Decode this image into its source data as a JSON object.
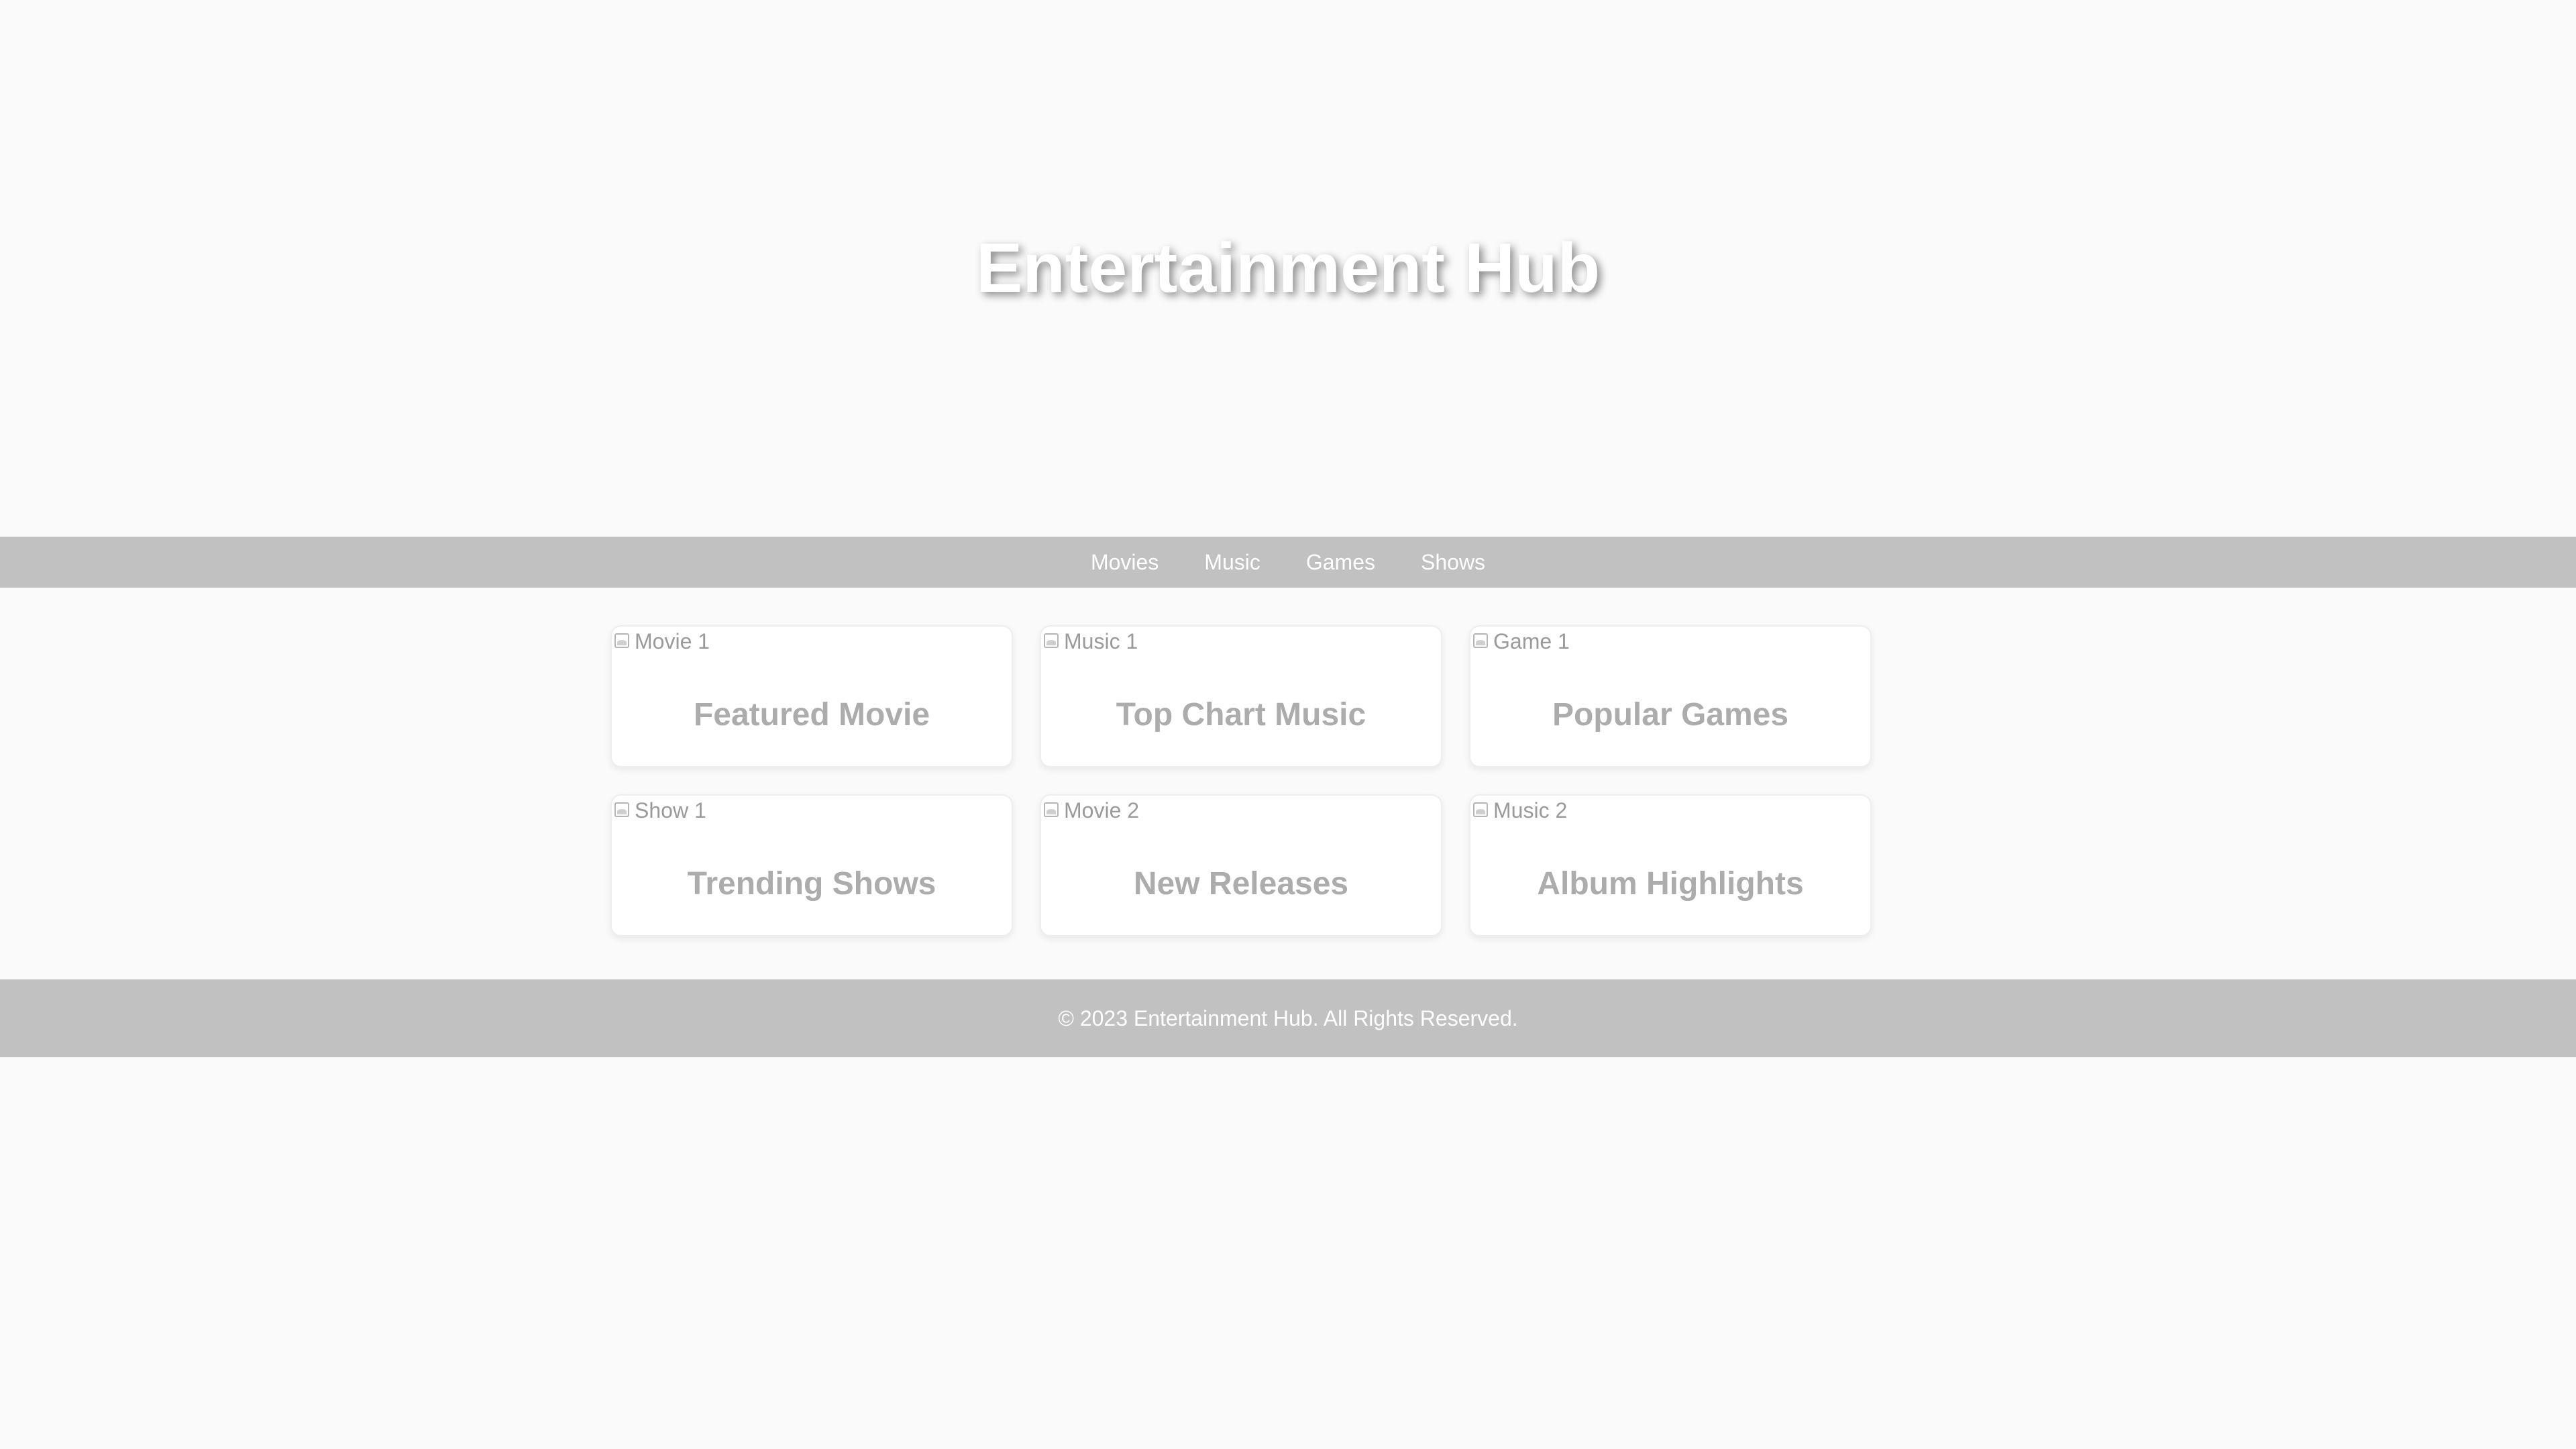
{
  "header": {
    "title": "Entertainment Hub"
  },
  "nav": {
    "items": [
      {
        "label": "Movies"
      },
      {
        "label": "Music"
      },
      {
        "label": "Games"
      },
      {
        "label": "Shows"
      }
    ]
  },
  "cards": [
    {
      "image_alt": "Movie 1",
      "title": "Featured Movie"
    },
    {
      "image_alt": "Music 1",
      "title": "Top Chart Music"
    },
    {
      "image_alt": "Game 1",
      "title": "Popular Games"
    },
    {
      "image_alt": "Show 1",
      "title": "Trending Shows"
    },
    {
      "image_alt": "Movie 2",
      "title": "New Releases"
    },
    {
      "image_alt": "Music 2",
      "title": "Album Highlights"
    }
  ],
  "footer": {
    "text": "© 2023 Entertainment Hub. All Rights Reserved."
  },
  "colors": {
    "background": "#fafafa",
    "nav_background": "#c1c1c1",
    "footer_background": "#c1c1c1",
    "card_title": "#acacac",
    "hero_title": "#ffffff"
  }
}
